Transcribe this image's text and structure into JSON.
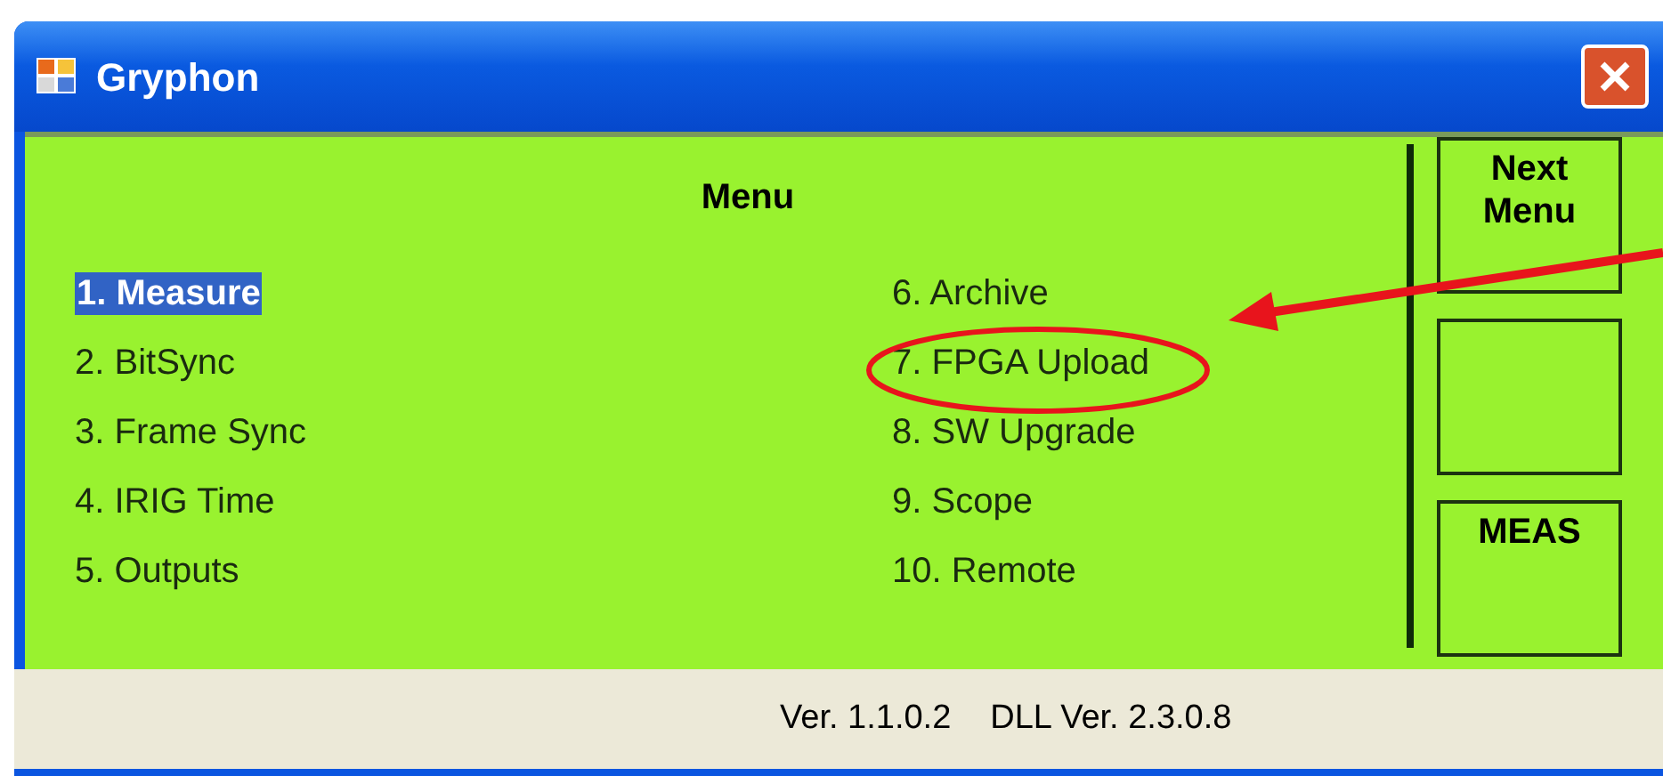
{
  "window": {
    "title": "Gryphon"
  },
  "menu": {
    "title": "Menu",
    "left_items": [
      {
        "label": "1. Measure",
        "selected": true,
        "circled": false
      },
      {
        "label": "2. BitSync",
        "selected": false,
        "circled": false
      },
      {
        "label": "3. Frame Sync",
        "selected": false,
        "circled": false
      },
      {
        "label": "4. IRIG Time",
        "selected": false,
        "circled": false
      },
      {
        "label": "5. Outputs",
        "selected": false,
        "circled": false
      }
    ],
    "right_items": [
      {
        "label": "6. Archive",
        "selected": false,
        "circled": false
      },
      {
        "label": "7. FPGA Upload",
        "selected": false,
        "circled": true
      },
      {
        "label": "8. SW Upgrade",
        "selected": false,
        "circled": false
      },
      {
        "label": "9. Scope",
        "selected": false,
        "circled": false
      },
      {
        "label": "10. Remote",
        "selected": false,
        "circled": false
      }
    ]
  },
  "softkeys": [
    {
      "kind": "labeled",
      "label": "Next Menu"
    },
    {
      "kind": "blank"
    },
    {
      "kind": "labeled",
      "label": "MEAS"
    }
  ],
  "status_bar": {
    "version": "Ver. 1.1.0.2",
    "dll_version": "DLL Ver. 2.3.0.8"
  }
}
